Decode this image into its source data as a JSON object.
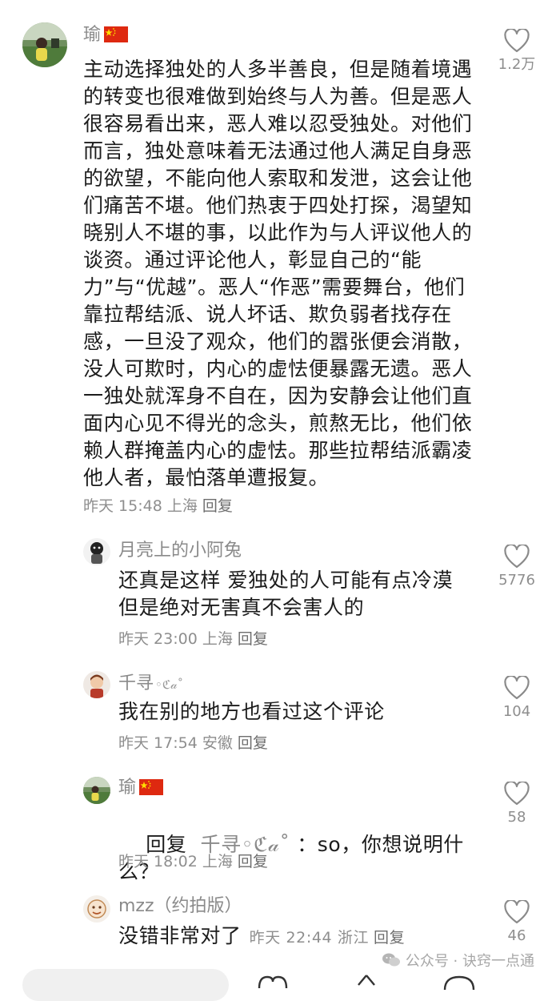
{
  "comments": [
    {
      "user": "瑜",
      "flag": "cn-flag",
      "text": "主动选择独处的人多半善良，但是随着境遇的转变也很难做到始终与人为善。但是恶人很容易看出来，恶人难以忍受独处。对他们而言，独处意味着无法通过他人满足自身恶的欲望，不能向他人索取和发泄，这会让他们痛苦不堪。他们热衷于四处打探，渴望知晓别人不堪的事，以此作为与人评议他人的谈资。通过评论他人，彰显自己的“能力”与“优越”。恶人“作恶”需要舞台，他们靠拉帮结派、说人坏话、欺负弱者找存在感，一旦没了观众，他们的嚣张便会消散，没人可欺时，内心的虚怯便暴露无遗。恶人一独处就浑身不自在，因为安静会让他们直面内心见不得光的念头，煎熬无比，他们依赖人群掩盖内心的虚怯。那些拉帮结派霸凌他人者，最怕落单遭报复。",
      "time": "昨天 15:48 上海",
      "reply": "回复",
      "likes": "1.2万"
    },
    {
      "user": "月亮上的小阿兔",
      "text": "还真是这样 爱独处的人可能有点冷漠 但是绝对无害真不会害人的",
      "time": "昨天 23:00 上海",
      "reply": "回复",
      "likes": "5776"
    },
    {
      "user": "千寻",
      "user_suffix": "◦ℭ𝒶˚",
      "text": "我在别的地方也看过这个评论",
      "time": "昨天 17:54 安徽",
      "reply": "回复",
      "likes": "104"
    },
    {
      "user": "瑜",
      "flag": "cn-flag",
      "reply_prefix": "回复",
      "reply_target": "千寻◦ℭ𝒶˚",
      "text": "：so，你想说明什么？",
      "time": "昨天 18:02 上海",
      "reply": "回复",
      "likes": "58"
    },
    {
      "user": "mzz（约拍版）",
      "text": "没错非常对了",
      "time": "昨天 22:44 浙江",
      "reply": "回复",
      "likes": "46"
    }
  ],
  "watermark": "公众号 · 诀窍一点通",
  "icons": {
    "like": "heart-outline-icon",
    "watermark": "wechat-icon"
  },
  "colors": {
    "text": "#1c1c1c",
    "meta": "#8e8e8e",
    "flag": "#de2910"
  }
}
